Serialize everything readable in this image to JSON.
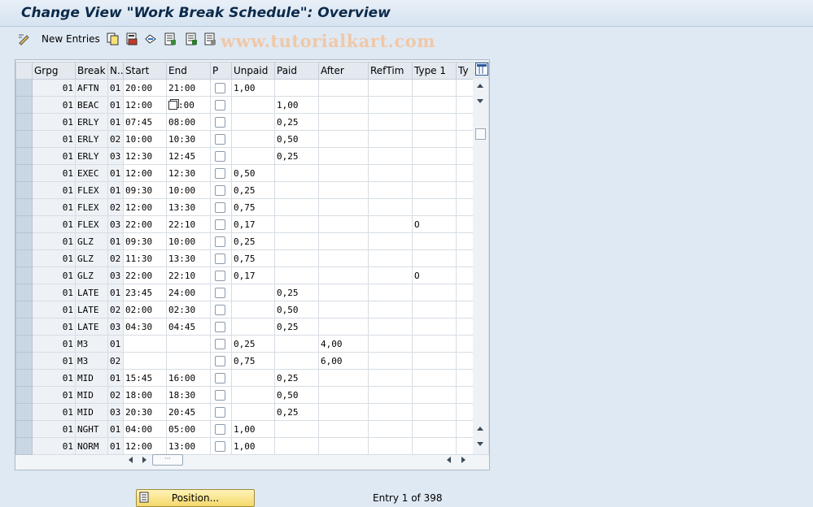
{
  "window": {
    "title": "Change View \"Work Break Schedule\": Overview"
  },
  "toolbar": {
    "new_entries_label": "New Entries",
    "icons": [
      "edit-icon",
      "copy-icon",
      "save-icon",
      "transport-icon",
      "table-icon",
      "table-select-icon",
      "table-deselect-icon"
    ]
  },
  "watermark": "www.tutorialkart.com",
  "table": {
    "headers": [
      "Grpg",
      "Break",
      "N..",
      "Start",
      "End",
      "P",
      "Unpaid",
      "Paid",
      "After",
      "RefTim",
      "Type 1",
      "Ty"
    ],
    "rows": [
      {
        "grpg": "01",
        "brk": "AFTN",
        "n": "01",
        "start": "20:00",
        "end": "21:00",
        "unpaid": "1,00",
        "paid": "",
        "after": "",
        "reftim": "",
        "type1": ""
      },
      {
        "grpg": "01",
        "brk": "BEAC",
        "n": "01",
        "start": "12:00",
        "end": ":00",
        "unpaid": "",
        "paid": "1,00",
        "after": "",
        "reftim": "",
        "type1": ""
      },
      {
        "grpg": "01",
        "brk": "ERLY",
        "n": "01",
        "start": "07:45",
        "end": "08:00",
        "unpaid": "",
        "paid": "0,25",
        "after": "",
        "reftim": "",
        "type1": ""
      },
      {
        "grpg": "01",
        "brk": "ERLY",
        "n": "02",
        "start": "10:00",
        "end": "10:30",
        "unpaid": "",
        "paid": "0,50",
        "after": "",
        "reftim": "",
        "type1": ""
      },
      {
        "grpg": "01",
        "brk": "ERLY",
        "n": "03",
        "start": "12:30",
        "end": "12:45",
        "unpaid": "",
        "paid": "0,25",
        "after": "",
        "reftim": "",
        "type1": ""
      },
      {
        "grpg": "01",
        "brk": "EXEC",
        "n": "01",
        "start": "12:00",
        "end": "12:30",
        "unpaid": "0,50",
        "paid": "",
        "after": "",
        "reftim": "",
        "type1": ""
      },
      {
        "grpg": "01",
        "brk": "FLEX",
        "n": "01",
        "start": "09:30",
        "end": "10:00",
        "unpaid": "0,25",
        "paid": "",
        "after": "",
        "reftim": "",
        "type1": ""
      },
      {
        "grpg": "01",
        "brk": "FLEX",
        "n": "02",
        "start": "12:00",
        "end": "13:30",
        "unpaid": "0,75",
        "paid": "",
        "after": "",
        "reftim": "",
        "type1": ""
      },
      {
        "grpg": "01",
        "brk": "FLEX",
        "n": "03",
        "start": "22:00",
        "end": "22:10",
        "unpaid": "0,17",
        "paid": "",
        "after": "",
        "reftim": "",
        "type1": "O"
      },
      {
        "grpg": "01",
        "brk": "GLZ",
        "n": "01",
        "start": "09:30",
        "end": "10:00",
        "unpaid": "0,25",
        "paid": "",
        "after": "",
        "reftim": "",
        "type1": ""
      },
      {
        "grpg": "01",
        "brk": "GLZ",
        "n": "02",
        "start": "11:30",
        "end": "13:30",
        "unpaid": "0,75",
        "paid": "",
        "after": "",
        "reftim": "",
        "type1": ""
      },
      {
        "grpg": "01",
        "brk": "GLZ",
        "n": "03",
        "start": "22:00",
        "end": "22:10",
        "unpaid": "0,17",
        "paid": "",
        "after": "",
        "reftim": "",
        "type1": "O"
      },
      {
        "grpg": "01",
        "brk": "LATE",
        "n": "01",
        "start": "23:45",
        "end": "24:00",
        "unpaid": "",
        "paid": "0,25",
        "after": "",
        "reftim": "",
        "type1": ""
      },
      {
        "grpg": "01",
        "brk": "LATE",
        "n": "02",
        "start": "02:00",
        "end": "02:30",
        "unpaid": "",
        "paid": "0,50",
        "after": "",
        "reftim": "",
        "type1": ""
      },
      {
        "grpg": "01",
        "brk": "LATE",
        "n": "03",
        "start": "04:30",
        "end": "04:45",
        "unpaid": "",
        "paid": "0,25",
        "after": "",
        "reftim": "",
        "type1": ""
      },
      {
        "grpg": "01",
        "brk": "M3",
        "n": "01",
        "start": "",
        "end": "",
        "unpaid": "0,25",
        "paid": "",
        "after": "4,00",
        "reftim": "",
        "type1": ""
      },
      {
        "grpg": "01",
        "brk": "M3",
        "n": "02",
        "start": "",
        "end": "",
        "unpaid": "0,75",
        "paid": "",
        "after": "6,00",
        "reftim": "",
        "type1": ""
      },
      {
        "grpg": "01",
        "brk": "MID",
        "n": "01",
        "start": "15:45",
        "end": "16:00",
        "unpaid": "",
        "paid": "0,25",
        "after": "",
        "reftim": "",
        "type1": ""
      },
      {
        "grpg": "01",
        "brk": "MID",
        "n": "02",
        "start": "18:00",
        "end": "18:30",
        "unpaid": "",
        "paid": "0,50",
        "after": "",
        "reftim": "",
        "type1": ""
      },
      {
        "grpg": "01",
        "brk": "MID",
        "n": "03",
        "start": "20:30",
        "end": "20:45",
        "unpaid": "",
        "paid": "0,25",
        "after": "",
        "reftim": "",
        "type1": ""
      },
      {
        "grpg": "01",
        "brk": "NGHT",
        "n": "01",
        "start": "04:00",
        "end": "05:00",
        "unpaid": "1,00",
        "paid": "",
        "after": "",
        "reftim": "",
        "type1": ""
      },
      {
        "grpg": "01",
        "brk": "NORM",
        "n": "01",
        "start": "12:00",
        "end": "13:00",
        "unpaid": "1,00",
        "paid": "",
        "after": "",
        "reftim": "",
        "type1": ""
      }
    ]
  },
  "footer": {
    "position_label": "Position...",
    "entry_text": "Entry 1 of 398"
  }
}
